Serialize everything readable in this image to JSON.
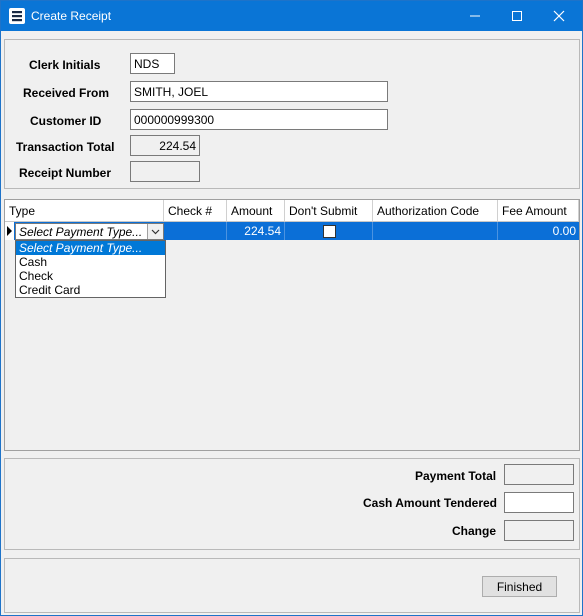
{
  "window": {
    "title": "Create Receipt"
  },
  "form": {
    "clerk_initials_label": "Clerk Initials",
    "clerk_initials_value": "NDS",
    "received_from_label": "Received From",
    "received_from_value": "SMITH, JOEL",
    "customer_id_label": "Customer ID",
    "customer_id_value": "000000999300",
    "transaction_total_label": "Transaction Total",
    "transaction_total_value": "224.54",
    "receipt_number_label": "Receipt Number",
    "receipt_number_value": ""
  },
  "grid": {
    "columns": [
      "Type",
      "Check #",
      "Amount",
      "Don't Submit",
      "Authorization Code",
      "Fee Amount"
    ],
    "row": {
      "type": "Select Payment Type...",
      "check_no": "",
      "amount": "224.54",
      "dont_submit": false,
      "authorization_code": "",
      "fee_amount": "0.00"
    },
    "type_options": [
      "Select Payment Type...",
      "Cash",
      "Check",
      "Credit Card"
    ],
    "selected_row_color": "#0b6fd7"
  },
  "totals": {
    "payment_total_label": "Payment Total",
    "payment_total_value": "",
    "cash_tendered_label": "Cash Amount Tendered",
    "cash_tendered_value": "",
    "change_label": "Change",
    "change_value": ""
  },
  "footer": {
    "finished_label": "Finished"
  },
  "colors": {
    "titlebar": "#0a75d6"
  }
}
